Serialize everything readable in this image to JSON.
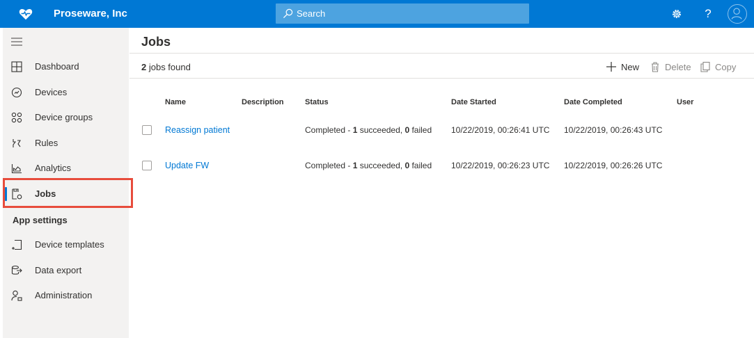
{
  "app": {
    "title": "Proseware, Inc",
    "search_placeholder": "Search",
    "brand_color": "#0078d4",
    "help_glyph": "?"
  },
  "sidebar": {
    "items": [
      {
        "label": "Dashboard",
        "icon": "dashboard-icon"
      },
      {
        "label": "Devices",
        "icon": "devices-icon"
      },
      {
        "label": "Device groups",
        "icon": "device-groups-icon"
      },
      {
        "label": "Rules",
        "icon": "rules-icon"
      },
      {
        "label": "Analytics",
        "icon": "analytics-icon"
      },
      {
        "label": "Jobs",
        "icon": "jobs-icon",
        "active": true
      }
    ],
    "section_label": "App settings",
    "settings_items": [
      {
        "label": "Device templates",
        "icon": "device-templates-icon"
      },
      {
        "label": "Data export",
        "icon": "data-export-icon"
      },
      {
        "label": "Administration",
        "icon": "administration-icon"
      }
    ]
  },
  "main": {
    "page_title": "Jobs",
    "job_count": "2",
    "job_count_suffix": " jobs found",
    "commands": {
      "new": "New",
      "delete": "Delete",
      "copy": "Copy"
    },
    "columns": [
      "Name",
      "Description",
      "Status",
      "Date Started",
      "Date Completed",
      "User"
    ],
    "rows": [
      {
        "name": "Reassign patient",
        "description": "",
        "status_prefix": "Completed - ",
        "succeeded": "1",
        "succeeded_label": " succeeded, ",
        "failed": "0",
        "failed_label": " failed",
        "date_started": "10/22/2019, 00:26:41 UTC",
        "date_completed": "10/22/2019, 00:26:43 UTC",
        "user": ""
      },
      {
        "name": "Update FW",
        "description": "",
        "status_prefix": "Completed - ",
        "succeeded": "1",
        "succeeded_label": " succeeded, ",
        "failed": "0",
        "failed_label": " failed",
        "date_started": "10/22/2019, 00:26:23 UTC",
        "date_completed": "10/22/2019, 00:26:26 UTC",
        "user": ""
      }
    ]
  }
}
